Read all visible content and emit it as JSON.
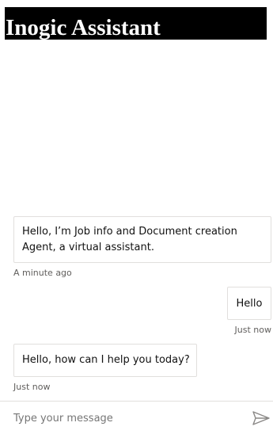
{
  "header": {
    "title": "Inogic Assistant"
  },
  "messages": [
    {
      "sender": "bot",
      "text": "Hello, I’m Job info and Document creation Agent, a virtual assistant.",
      "timestamp": "A minute ago"
    },
    {
      "sender": "user",
      "text": "Hello",
      "timestamp": "Just now"
    },
    {
      "sender": "bot",
      "text": "Hello, how can I help you today?",
      "timestamp": "Just now"
    }
  ],
  "composer": {
    "placeholder": "Type your message",
    "value": "",
    "send_icon": "send-icon"
  },
  "colors": {
    "header_background": "#000000",
    "header_text": "#ffffff",
    "bubble_border": "#e1dfdd",
    "timestamp_text": "#605e5c",
    "send_icon": "#8a8886"
  }
}
